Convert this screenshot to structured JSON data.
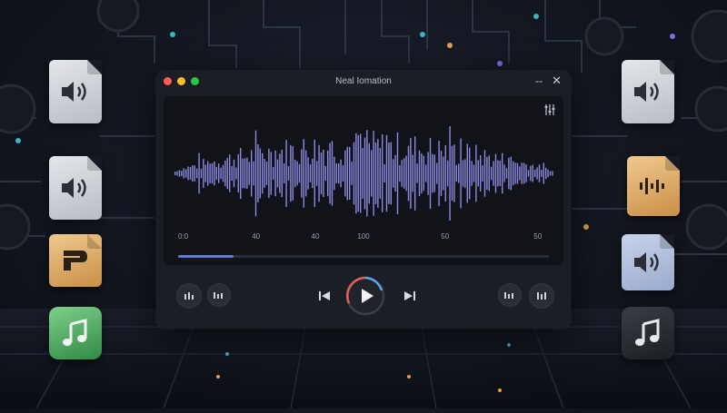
{
  "window": {
    "title": "Neal Iomation",
    "minimize_label": "--",
    "close_label": "✕"
  },
  "timeline": {
    "ticks": [
      "0:0",
      "40",
      "40",
      "100",
      "50",
      "50"
    ],
    "progress_fraction": 0.15
  },
  "icons": {
    "left": [
      "speaker-file-icon",
      "speaker-file-icon",
      "letter-p-app-icon",
      "music-note-app-icon"
    ],
    "right": [
      "speaker-file-icon",
      "waveform-file-icon",
      "speaker-file-icon",
      "music-note-app-icon"
    ]
  },
  "colors": {
    "accent": "#5b7fd8",
    "wave_start": "#a78bdc",
    "wave_end": "#6f8fe0",
    "play_ring_red": "#e0605a",
    "play_ring_blue": "#5aa6e8"
  }
}
